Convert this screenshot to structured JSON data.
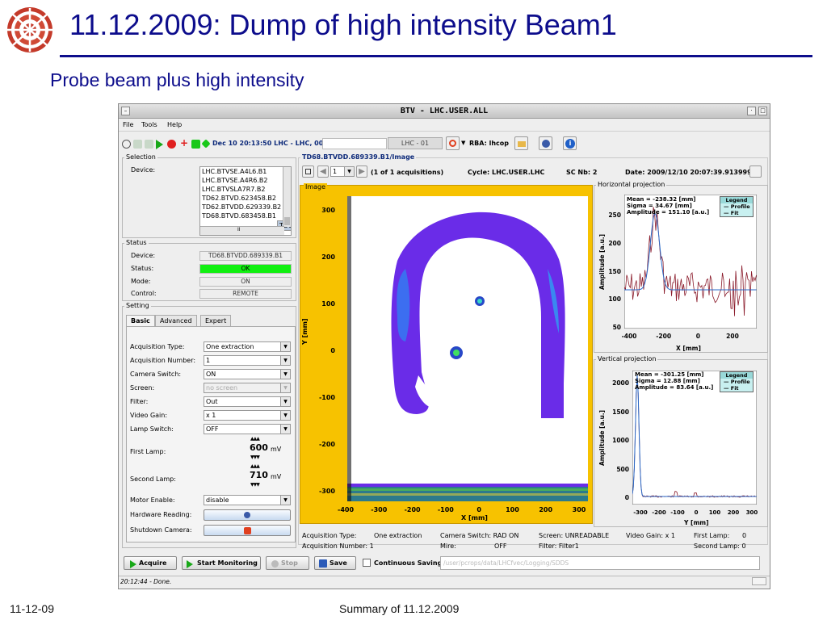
{
  "slide": {
    "title": "11.12.2009: Dump of high intensity Beam1",
    "subtitle": "Probe beam plus high intensity",
    "footer_left": "11-12-09",
    "footer_center": "Summary of 11.12.2009",
    "accent": "#0d0d8c"
  },
  "window": {
    "title": "BTV - LHC.USER.ALL",
    "menu": [
      "File",
      "Tools",
      "Help"
    ],
    "toolbar": {
      "time_text": "Dec 10 20:13:50  LHC - LHC, 00",
      "lhc_field": "LHC - 01",
      "rba_label": "RBA: lhcop"
    },
    "selection": {
      "group_label": "Selection",
      "device_label": "Device:",
      "devices": [
        "LHC.BTVSE.A4L6.B1",
        "LHC.BTVSE.A4R6.B2",
        "LHC.BTVSLA7R7.B2",
        "TD62.BTVD.623458.B2",
        "TD62.BTVDD.629339.B2",
        "TD68.BTVD.683458.B1",
        "TD68.BTVDD.689339.B1"
      ],
      "selected_index": 6,
      "hscroll_label": "II"
    },
    "status": {
      "group_label": "Status",
      "rows": [
        {
          "label": "Device:",
          "value": "TD68.BTVDD.689339.B1"
        },
        {
          "label": "Status:",
          "value": "OK"
        },
        {
          "label": "Mode:",
          "value": "ON"
        },
        {
          "label": "Control:",
          "value": "REMOTE"
        }
      ],
      "ok_color": "#10f010"
    },
    "setting": {
      "group_label": "Setting",
      "tabs": [
        "Basic",
        "Advanced",
        "Expert"
      ],
      "active_tab": "Basic",
      "fields": [
        {
          "label": "Acquisition Type:",
          "value": "One extraction"
        },
        {
          "label": "Acquisition Number:",
          "value": "1"
        },
        {
          "label": "Camera Switch:",
          "value": "ON"
        },
        {
          "label": "Screen:",
          "value": "no screen",
          "disabled": true
        },
        {
          "label": "Filter:",
          "value": "Out"
        },
        {
          "label": "Video Gain:",
          "value": "x 1"
        },
        {
          "label": "Lamp Switch:",
          "value": "OFF"
        }
      ],
      "first_lamp": {
        "label": "First Lamp:",
        "value": "600",
        "unit": "mV"
      },
      "second_lamp": {
        "label": "Second Lamp:",
        "value": "710",
        "unit": "mV"
      },
      "motor_enable": {
        "label": "Motor Enable:",
        "value": "disable"
      },
      "hardware_reading_label": "Hardware Reading:",
      "shutdown_camera_label": "Shutdown Camera:"
    },
    "image_panel": {
      "title": "TD68.BTVDD.689339.B1/Image",
      "acq_index": "1",
      "acq_text": "(1 of 1 acquisitions)",
      "cycle": "Cycle: LHC.USER.LHC",
      "sc_nb": "SC Nb: 2",
      "date": "Date:  2009/12/10 20:07:39.913999",
      "image_label": "Image",
      "x_label": "X [mm]",
      "y_label": "Y [mm]",
      "x_ticks": [
        "-400",
        "-300",
        "-200",
        "-100",
        "0",
        "100",
        "200",
        "300"
      ],
      "y_ticks": [
        "300",
        "200",
        "100",
        "0",
        "-100",
        "-200",
        "-300"
      ],
      "frame_color": "#f7c200"
    },
    "hproj": {
      "title": "Horizontal projection",
      "stats": [
        "Mean = -238.32 [mm]",
        "Sigma = 34.67 [mm]",
        "Amplitude = 151.10 [a.u.]"
      ],
      "legend_title": "Legend",
      "legend": [
        "Profile",
        "Fit"
      ],
      "x_label": "X [mm]",
      "y_label": "Amplitude [a.u.]",
      "x_ticks": [
        "-400",
        "-200",
        "0",
        "200"
      ],
      "y_ticks": [
        "250",
        "200",
        "150",
        "100",
        "50"
      ]
    },
    "vproj": {
      "title": "Vertical projection",
      "stats": [
        "Mean = -301.25 [mm]",
        "Sigma = 12.88 [mm]",
        "Amplitude = 83.64 [a.u.]"
      ],
      "legend_title": "Legend",
      "legend": [
        "Profile",
        "Fit"
      ],
      "x_label": "Y [mm]",
      "y_label": "Amplitude [a.u.]",
      "x_ticks": [
        "-300",
        "-200",
        "-100",
        "0",
        "100",
        "200",
        "300"
      ],
      "y_ticks": [
        "2000",
        "1500",
        "1000",
        "500",
        "0"
      ]
    },
    "acq_info": {
      "acq_type": "Acquisition Type:",
      "acq_type_val": "One extraction",
      "camera_switch": "Camera Switch: RAD ON",
      "screen": "Screen: UNREADABLE",
      "video_gain": "Video Gain: x 1",
      "first_lamp": "First Lamp:",
      "first_lamp_val": "0",
      "acq_number": "Acquisition Number: 1",
      "mire": "Mire:",
      "mire_val": "OFF",
      "filter": "Filter:   Filter1",
      "second_lamp": "Second Lamp: 0"
    },
    "buttons": {
      "acquire": "Acquire",
      "start_monitoring": "Start Monitoring",
      "stop": "Stop",
      "save": "Save",
      "continuous_saving": "Continuous Saving",
      "path": "/user/pcrops/data/LHCfvec/Logging/SDDS"
    },
    "statusbar": "20:12:44 - Done."
  }
}
